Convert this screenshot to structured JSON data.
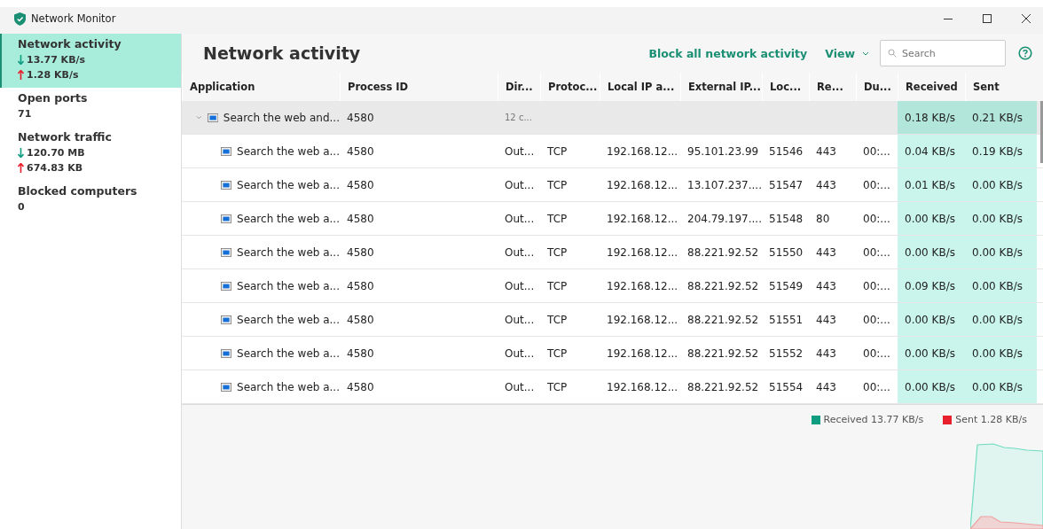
{
  "window": {
    "title": "Network Monitor"
  },
  "sidebar": {
    "items": [
      {
        "title": "Network activity",
        "selected": true,
        "values": [
          {
            "kind": "down",
            "text": "13.77 KB/s"
          },
          {
            "kind": "up",
            "text": "1.28 KB/s"
          }
        ]
      },
      {
        "title": "Open ports",
        "selected": false,
        "values": [
          {
            "kind": "plain",
            "text": "71"
          }
        ]
      },
      {
        "title": "Network traffic",
        "selected": false,
        "values": [
          {
            "kind": "down",
            "text": "120.70 MB"
          },
          {
            "kind": "up",
            "text": "674.83 KB"
          }
        ]
      },
      {
        "title": "Blocked computers",
        "selected": false,
        "values": [
          {
            "kind": "plain",
            "text": "0"
          }
        ]
      }
    ]
  },
  "header": {
    "title": "Network activity",
    "block_link": "Block all network activity",
    "view_menu": "View",
    "search": {
      "placeholder": "Search"
    }
  },
  "table": {
    "columns": [
      "Application",
      "Process ID",
      "Dir...",
      "Protoc...",
      "Local IP a...",
      "External IP...",
      "Loc...",
      "Re...",
      "Du...",
      "Received",
      "Sent"
    ],
    "group": {
      "expanded": true,
      "application": "Search the web and...",
      "process_id": "4580",
      "summary": "12 c...",
      "received": "0.18 KB/s",
      "sent": "0.21 KB/s"
    },
    "rows": [
      [
        "Search the web a...",
        "4580",
        "Out...",
        "TCP",
        "192.168.12...",
        "95.101.23.99",
        "51546",
        "443",
        "00:...",
        "0.04 KB/s",
        "0.19 KB/s"
      ],
      [
        "Search the web a...",
        "4580",
        "Out...",
        "TCP",
        "192.168.12...",
        "13.107.237....",
        "51547",
        "443",
        "00:...",
        "0.01 KB/s",
        "0.00 KB/s"
      ],
      [
        "Search the web a...",
        "4580",
        "Out...",
        "TCP",
        "192.168.12...",
        "204.79.197....",
        "51548",
        "80",
        "00:...",
        "0.00 KB/s",
        "0.00 KB/s"
      ],
      [
        "Search the web a...",
        "4580",
        "Out...",
        "TCP",
        "192.168.12...",
        "88.221.92.52",
        "51550",
        "443",
        "00:...",
        "0.00 KB/s",
        "0.00 KB/s"
      ],
      [
        "Search the web a...",
        "4580",
        "Out...",
        "TCP",
        "192.168.12...",
        "88.221.92.52",
        "51549",
        "443",
        "00:...",
        "0.09 KB/s",
        "0.00 KB/s"
      ],
      [
        "Search the web a...",
        "4580",
        "Out...",
        "TCP",
        "192.168.12...",
        "88.221.92.52",
        "51551",
        "443",
        "00:...",
        "0.00 KB/s",
        "0.00 KB/s"
      ],
      [
        "Search the web a...",
        "4580",
        "Out...",
        "TCP",
        "192.168.12...",
        "88.221.92.52",
        "51552",
        "443",
        "00:...",
        "0.00 KB/s",
        "0.00 KB/s"
      ],
      [
        "Search the web a...",
        "4580",
        "Out...",
        "TCP",
        "192.168.12...",
        "88.221.92.52",
        "51554",
        "443",
        "00:...",
        "0.00 KB/s",
        "0.00 KB/s"
      ]
    ]
  },
  "legend": [
    {
      "label": "Received 13.77 KB/s",
      "color": "#0f9d82"
    },
    {
      "label": "Sent 1.28 KB/s",
      "color": "#e8202e"
    }
  ]
}
